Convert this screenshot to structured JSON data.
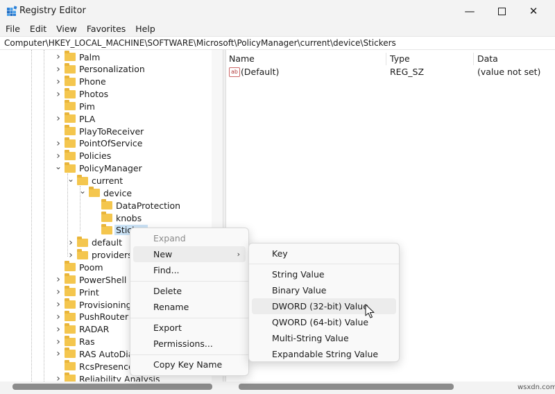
{
  "window": {
    "title": "Registry Editor",
    "minimize_glyph": "—",
    "close_glyph": "✕"
  },
  "menu": [
    "File",
    "Edit",
    "View",
    "Favorites",
    "Help"
  ],
  "address": "Computer\\HKEY_LOCAL_MACHINE\\SOFTWARE\\Microsoft\\PolicyManager\\current\\device\\Stickers",
  "tree": [
    {
      "label": "Palm",
      "state": "collapsed"
    },
    {
      "label": "Personalization",
      "state": "collapsed"
    },
    {
      "label": "Phone",
      "state": "collapsed"
    },
    {
      "label": "Photos",
      "state": "collapsed"
    },
    {
      "label": "Pim",
      "state": "none"
    },
    {
      "label": "PLA",
      "state": "collapsed"
    },
    {
      "label": "PlayToReceiver",
      "state": "none"
    },
    {
      "label": "PointOfService",
      "state": "collapsed"
    },
    {
      "label": "Policies",
      "state": "collapsed"
    },
    {
      "label": "PolicyManager",
      "state": "expanded"
    },
    {
      "label": "current",
      "state": "expanded"
    },
    {
      "label": "device",
      "state": "expanded"
    },
    {
      "label": "DataProtection",
      "state": "none"
    },
    {
      "label": "knobs",
      "state": "none"
    },
    {
      "label": "Stick",
      "state": "none",
      "selected": true
    },
    {
      "label": "default",
      "state": "collapsed"
    },
    {
      "label": "providers",
      "state": "collapsed"
    },
    {
      "label": "Poom",
      "state": "none"
    },
    {
      "label": "PowerShell",
      "state": "collapsed"
    },
    {
      "label": "Print",
      "state": "collapsed"
    },
    {
      "label": "Provisioning",
      "state": "collapsed"
    },
    {
      "label": "PushRouter",
      "state": "collapsed"
    },
    {
      "label": "RADAR",
      "state": "collapsed"
    },
    {
      "label": "Ras",
      "state": "collapsed"
    },
    {
      "label": "RAS AutoDial",
      "state": "collapsed"
    },
    {
      "label": "RcsPresence",
      "state": "none"
    },
    {
      "label": "Reliability Analysis",
      "state": "collapsed"
    }
  ],
  "values_pane": {
    "columns": [
      "Name",
      "Type",
      "Data"
    ],
    "rows": [
      {
        "icon_text": "ab",
        "name": "(Default)",
        "type": "REG_SZ",
        "data": "(value not set)"
      }
    ]
  },
  "context_menu": {
    "items": [
      {
        "label": "Expand",
        "disabled": true
      },
      {
        "label": "New",
        "submenu": true,
        "hover": true
      },
      {
        "label": "Find..."
      },
      {
        "label": "Delete"
      },
      {
        "label": "Rename"
      },
      {
        "label": "Export"
      },
      {
        "label": "Permissions..."
      },
      {
        "label": "Copy Key Name"
      }
    ]
  },
  "submenu": {
    "items": [
      {
        "label": "Key"
      },
      {
        "label": "String Value"
      },
      {
        "label": "Binary Value"
      },
      {
        "label": "DWORD (32-bit) Value",
        "hover": true
      },
      {
        "label": "QWORD (64-bit) Value"
      },
      {
        "label": "Multi-String Value"
      },
      {
        "label": "Expandable String Value"
      }
    ]
  },
  "watermark": "wsxdn.com",
  "colors": {
    "folder": "#f4c64e",
    "selection": "#cce4f7",
    "accent": "#0067c0"
  }
}
